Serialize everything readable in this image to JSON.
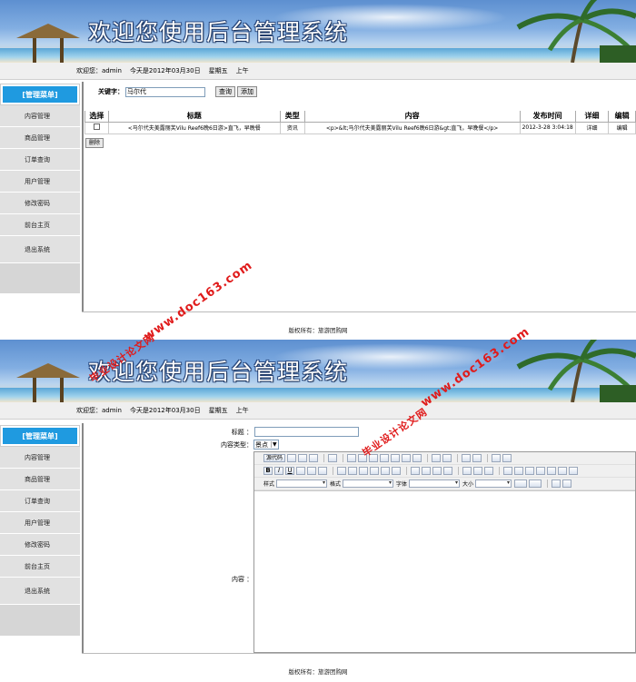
{
  "banner": {
    "title": "欢迎您使用后台管理系统"
  },
  "infobar": {
    "welcome": "欢迎您：admin",
    "date": "今天是2012年03月30日",
    "weekday": "星期五",
    "ampm": "上午"
  },
  "sidebar": {
    "header": "[管理菜单]",
    "items": [
      "内容管理",
      "商品管理",
      "订单查询",
      "用户管理",
      "修改密码",
      "前台主页",
      "退出系统"
    ]
  },
  "search": {
    "label": "关键字：",
    "value": "马尔代",
    "query_button": "查询",
    "add_button": "添加"
  },
  "table": {
    "headers": [
      "选择",
      "标题",
      "类型",
      "内容",
      "发布时间",
      "详细",
      "编辑"
    ],
    "rows": [
      {
        "title": "<马尔代夫美露丽芙Vilu Reef6晚6日游>直飞，早晚餐",
        "type": "资讯",
        "content": "<p>&lt;马尔代夫美露丽芙Vilu Reef6晚6日游&gt;直飞，早晚餐</p>",
        "time": "2012-3-28 3:04:18",
        "detail": "详细",
        "edit": "编辑"
      }
    ],
    "delete_button": "删除"
  },
  "footer": {
    "text": "版权所有：旅游团购网"
  },
  "form": {
    "title_label": "标题 ：",
    "type_label": "内容类型：",
    "type_value": "景点",
    "content_label": "内容 ："
  },
  "editor": {
    "source_button": "源代码",
    "style_label": "样式",
    "format_label": "格式",
    "font_label": "字体",
    "size_label": "大小"
  },
  "watermark": {
    "site": "www.doc163.com",
    "cn": "毕业设计论文网"
  },
  "colors": {
    "menu_header": "#1f9ae0",
    "watermark": "#e01b1b"
  }
}
